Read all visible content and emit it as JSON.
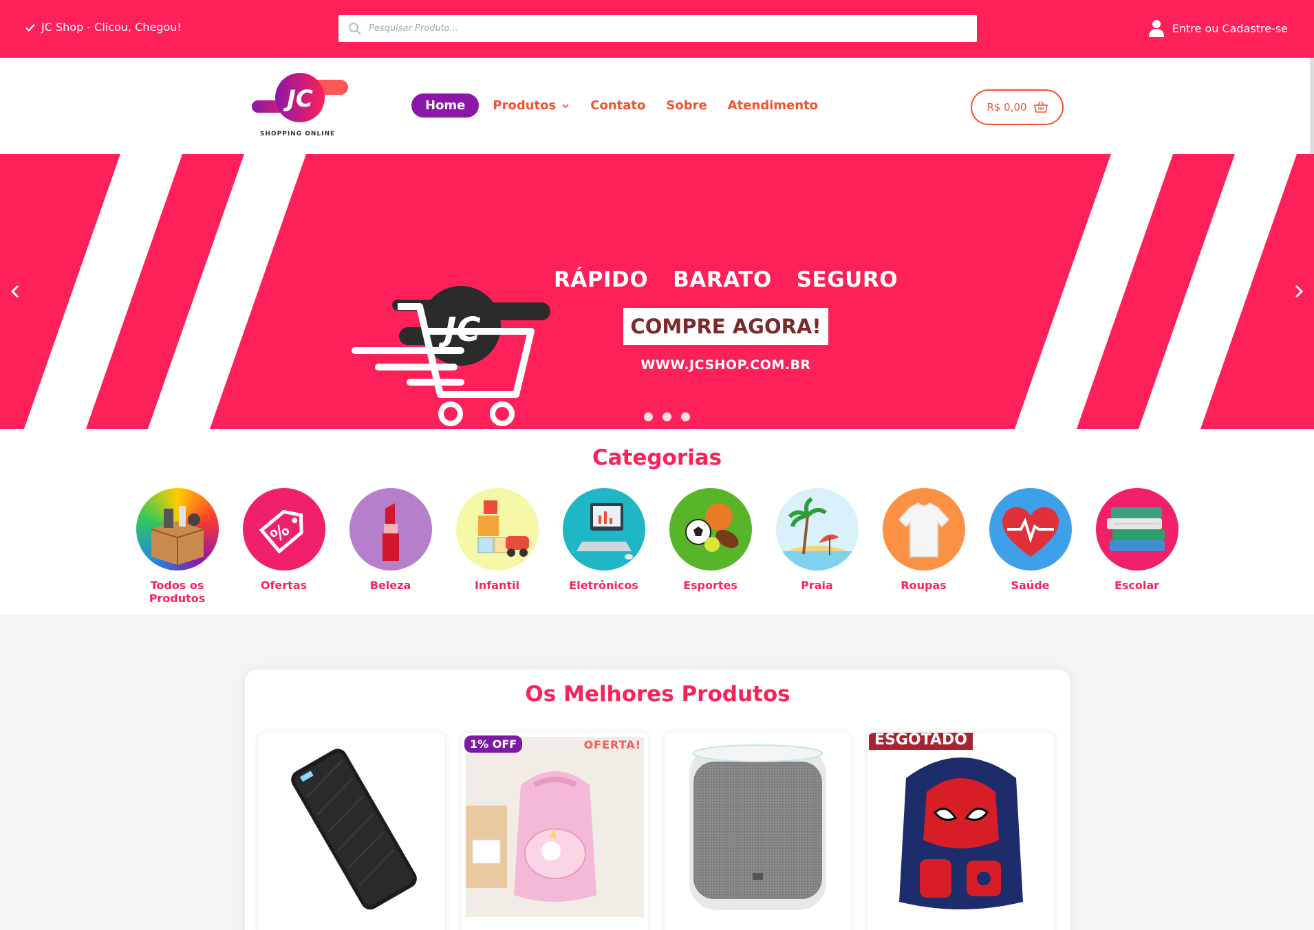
{
  "topbar": {
    "tagline": "JC Shop - Clicou, Chegou!",
    "search_placeholder": "Pesquisar Produto...",
    "login_label": "Entre ou Cadastre-se"
  },
  "header": {
    "logo_text": "JC",
    "logo_subtitle": "SHOPPING ONLINE",
    "nav": [
      {
        "label": "Home",
        "active": true
      },
      {
        "label": "Produtos",
        "has_dropdown": true
      },
      {
        "label": "Contato"
      },
      {
        "label": "Sobre"
      },
      {
        "label": "Atendimento"
      }
    ],
    "cart_total": "R$ 0,00"
  },
  "hero": {
    "words": [
      "RÁPIDO",
      "BARATO",
      "SEGURO"
    ],
    "cta": "COMPRE AGORA!",
    "url": "WWW.JCSHOP.COM.BR",
    "logo_text": "JC",
    "slide_count": 3
  },
  "categories": {
    "title": "Categorias",
    "items": [
      {
        "label": "Todos os Produtos",
        "icon": "box-icon"
      },
      {
        "label": "Ofertas",
        "icon": "discount-tag-icon"
      },
      {
        "label": "Beleza",
        "icon": "lipstick-icon"
      },
      {
        "label": "Infantil",
        "icon": "toy-blocks-icon"
      },
      {
        "label": "Eletrônicos",
        "icon": "computer-icon"
      },
      {
        "label": "Esportes",
        "icon": "balls-icon"
      },
      {
        "label": "Praia",
        "icon": "beach-icon"
      },
      {
        "label": "Roupas",
        "icon": "shirt-icon"
      },
      {
        "label": "Saúde",
        "icon": "heart-pulse-icon"
      },
      {
        "label": "Escolar",
        "icon": "books-icon"
      }
    ]
  },
  "products": {
    "title": "Os Melhores Produtos",
    "items": [
      {
        "name": "power-bank",
        "badges": []
      },
      {
        "name": "unicorn-backpack",
        "discount": "1% OFF",
        "offer": "OFERTA!"
      },
      {
        "name": "smart-speaker",
        "badges": []
      },
      {
        "name": "spiderman-backpack",
        "sold_out": "ESGOTADO"
      }
    ]
  },
  "colors": {
    "brand_pink": "#fe2159",
    "nav_orange": "#f2522e",
    "active_purple": "#8b17a8"
  }
}
